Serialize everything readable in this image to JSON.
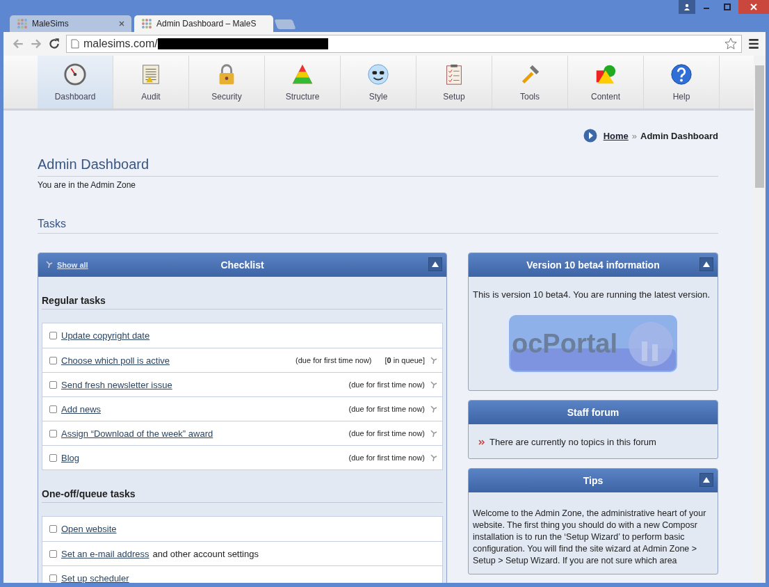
{
  "browser_tabs": [
    {
      "label": "MaleSims",
      "selected": false
    },
    {
      "label": "Admin Dashboard – MaleS",
      "selected": true
    }
  ],
  "address_bar": {
    "url": "malesims.com/",
    "redacted": true
  },
  "nav": [
    {
      "label": "Dashboard",
      "selected": true
    },
    {
      "label": "Audit",
      "selected": false
    },
    {
      "label": "Security",
      "selected": false
    },
    {
      "label": "Structure",
      "selected": false
    },
    {
      "label": "Style",
      "selected": false
    },
    {
      "label": "Setup",
      "selected": false
    },
    {
      "label": "Tools",
      "selected": false
    },
    {
      "label": "Content",
      "selected": false
    },
    {
      "label": "Help",
      "selected": false
    }
  ],
  "breadcrumb": {
    "home": "Home",
    "separator": "»",
    "current": "Admin Dashboard"
  },
  "page_title": "Admin Dashboard",
  "subtitle": "You are in the Admin Zone",
  "section_title": "Tasks",
  "checklist": {
    "show_all": "Show all",
    "title": "Checklist",
    "collapsible": true,
    "groups": [
      {
        "title": "Regular tasks",
        "items": [
          {
            "link": "Update copyright date",
            "checked": false
          },
          {
            "link": "Choose which poll is active",
            "checked": false,
            "due": "(due for first time now)",
            "queue": "[**0** in queue]"
          },
          {
            "link": "Send fresh newsletter issue",
            "checked": false,
            "due": "(due for first time now)"
          },
          {
            "link": "Add news",
            "checked": false,
            "due": "(due for first time now)"
          },
          {
            "link": "Assign “Download of the week” award",
            "checked": false,
            "due": "(due for first time now)"
          },
          {
            "link": "Blog",
            "checked": false,
            "due": "(due for first time now)"
          }
        ]
      },
      {
        "title": "One-off/queue tasks",
        "items": [
          {
            "link": "Open website",
            "checked": false
          },
          {
            "link": "Set an e-mail address",
            "after": "and other account settings",
            "checked": false
          },
          {
            "link": "Set up scheduler",
            "checked": false
          }
        ]
      }
    ]
  },
  "side_boxes": [
    {
      "title": "Version 10 beta4 information",
      "collapsible": true,
      "kind": "version",
      "text": "This is version 10 beta4. You are running the latest version.",
      "logo_text": "ocPortal"
    },
    {
      "title": "Staff forum",
      "collapsible": false,
      "kind": "forum",
      "text": "There are currently no topics in this forum"
    },
    {
      "title": "Tips",
      "collapsible": true,
      "kind": "tips",
      "text": "Welcome to the Admin Zone, the administrative heart of your website. The first thing you should do with a new Composr installation is to run the ‘Setup Wizard’ to perform basic configuration. You will find the site wizard at Admin Zone > Setup > Setup Wizard. If you are not sure which area"
    }
  ]
}
